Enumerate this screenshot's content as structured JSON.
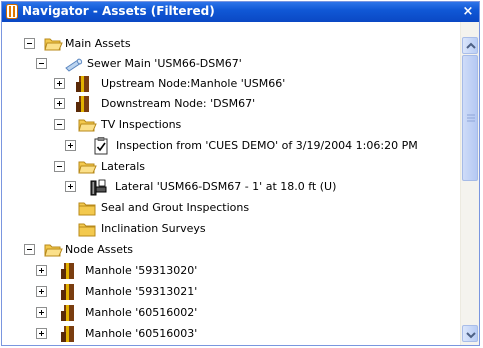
{
  "window": {
    "title": "Navigator - Assets (Filtered)",
    "close_glyph": "×"
  },
  "tree": {
    "main_assets": "Main Assets",
    "sewer_main": "Sewer Main 'USM66-DSM67'",
    "upstream_node": "Upstream Node:Manhole 'USM66'",
    "downstream_node": "Downstream Node: 'DSM67'",
    "tv_inspections": "TV Inspections",
    "inspection": "Inspection from 'CUES DEMO' of 3/19/2004 1:06:20 PM",
    "laterals": "Laterals",
    "lateral": "Lateral 'USM66-DSM67 - 1' at 18.0 ft (U)",
    "seal_grout": "Seal and Grout Inspections",
    "inclination": "Inclination Surveys",
    "node_assets": "Node Assets",
    "manholes": [
      "Manhole '59313020'",
      "Manhole '59313021'",
      "Manhole '60516002'",
      "Manhole '60516003'"
    ]
  },
  "colors": {
    "titlebar": "#0a48c4",
    "folder": "#f3c94e",
    "manhole_brown": "#7a3d10",
    "manhole_yellow": "#e3b200"
  }
}
